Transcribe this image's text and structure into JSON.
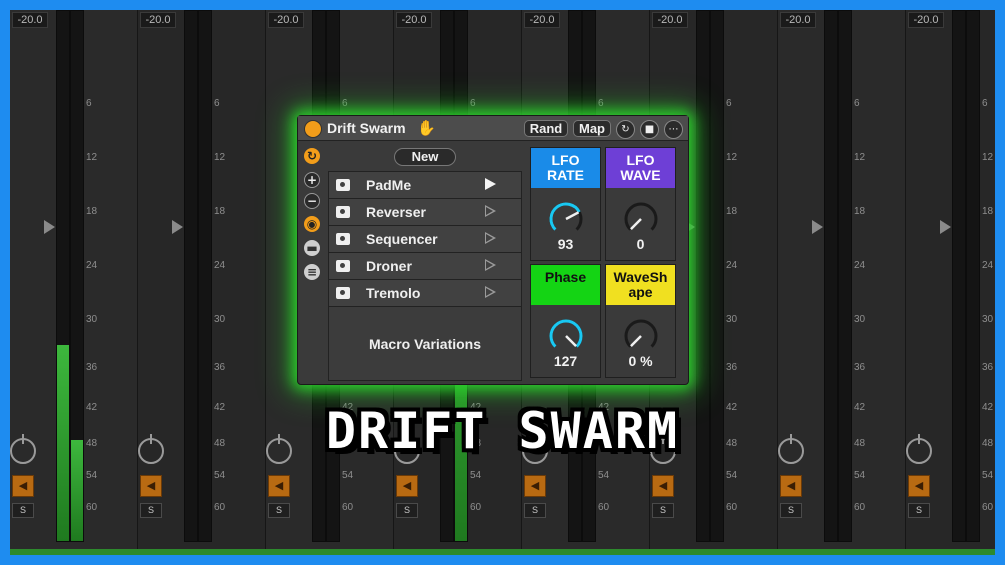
{
  "mixer": {
    "volume_readout": "-20.0",
    "db_scale": [
      "6",
      "12",
      "18",
      "24",
      "30",
      "36",
      "42",
      "48",
      "54",
      "60"
    ],
    "solo_label": "S",
    "meter_levels_percent": [
      37,
      19,
      0,
      0,
      0,
      0,
      0,
      64,
      0,
      0,
      0,
      0,
      0,
      0,
      0,
      0
    ],
    "accent_green": "#2bd12b"
  },
  "device": {
    "title": "Drift Swarm",
    "header_buttons": {
      "rand": "Rand",
      "map": "Map"
    },
    "header_icons": [
      "hot-swap-icon",
      "save-icon",
      "more-options-icon"
    ],
    "new_button": "New",
    "variations": [
      {
        "label": "PadMe",
        "active": true
      },
      {
        "label": "Reverser",
        "active": false
      },
      {
        "label": "Sequencer",
        "active": false
      },
      {
        "label": "Droner",
        "active": false
      },
      {
        "label": "Tremolo",
        "active": false
      }
    ],
    "macro_variations_label": "Macro Variations",
    "macros": [
      {
        "name": "LFO\nRATE",
        "value": "93",
        "color": "#1a8be8",
        "text_color": "#ffffff",
        "knob_level": 0.73
      },
      {
        "name": "LFO\nWAVE",
        "value": "0",
        "color": "#6e3fd6",
        "text_color": "#ffffff",
        "knob_level": 0.0
      },
      {
        "name": "Phase",
        "value": "127",
        "color": "#14d414",
        "text_color": "#111111",
        "knob_level": 1.0
      },
      {
        "name": "WaveSh\nape",
        "value": "0 %",
        "color": "#f0e020",
        "text_color": "#111111",
        "knob_level": 0.0
      }
    ]
  },
  "overlay_title": "DRIFT SWARM"
}
